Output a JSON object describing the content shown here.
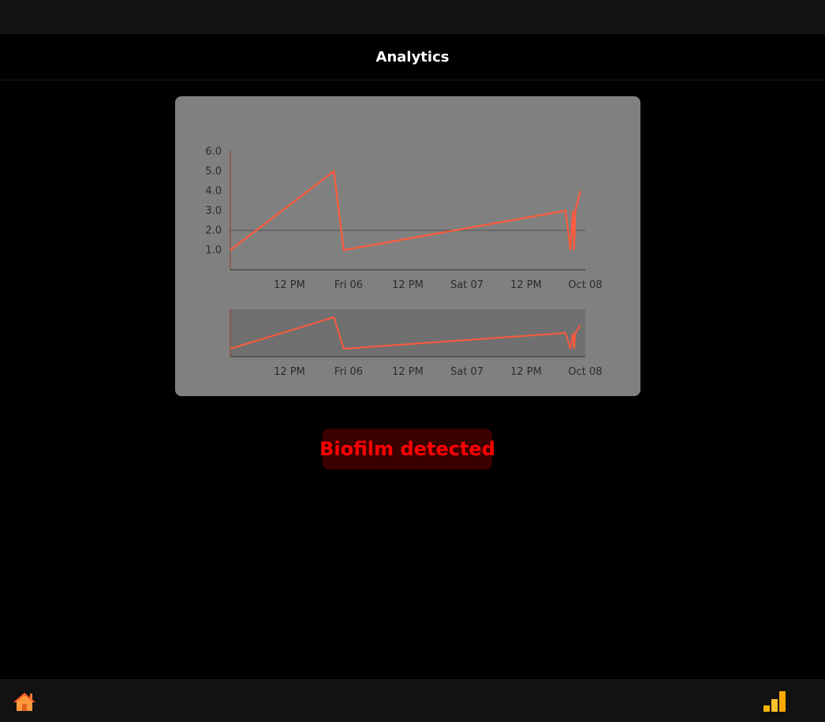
{
  "header": {
    "title": "Analytics"
  },
  "alert": {
    "text": "Biofilm detected",
    "color": "#ff0000",
    "background": "#3a0000"
  },
  "nav": {
    "home_icon": "home-icon",
    "analytics_icon": "bar-chart-icon"
  },
  "colors": {
    "series": "#ff5a3c",
    "card": "#808080",
    "navigator_bg": "#707070"
  },
  "chart_data": {
    "type": "line",
    "y_ticks": [
      "1.0",
      "2.0",
      "3.0",
      "4.0",
      "5.0",
      "6.0"
    ],
    "ylim": [
      0,
      6
    ],
    "x_ticks": [
      "12 PM",
      "Fri 06",
      "12 PM",
      "Sat 07",
      "12 PM",
      "Oct 08"
    ],
    "x_tick_times": [
      "2020-10-05T12:00",
      "2020-10-06T00:00",
      "2020-10-06T12:00",
      "2020-10-07T00:00",
      "2020-10-07T12:00",
      "2020-10-08T00:00"
    ],
    "xlim": [
      "2020-10-05T00:00",
      "2020-10-08T00:00"
    ],
    "reference_line": 2,
    "grid": false,
    "series": [
      {
        "x": [
          "2020-10-05T00:00",
          "2020-10-05T21:00",
          "2020-10-05T23:00",
          "2020-10-07T20:00",
          "2020-10-07T21:00",
          "2020-10-07T21:30",
          "2020-10-07T21:45",
          "2020-10-07T22:00",
          "2020-10-07T23:00"
        ],
        "values": [
          1.0,
          5.0,
          1.0,
          3.0,
          1.0,
          3.0,
          1.0,
          3.0,
          4.0
        ]
      }
    ],
    "navigator": {
      "x_ticks": [
        "12 PM",
        "Fri 06",
        "12 PM",
        "Sat 07",
        "12 PM",
        "Oct 08"
      ]
    }
  }
}
